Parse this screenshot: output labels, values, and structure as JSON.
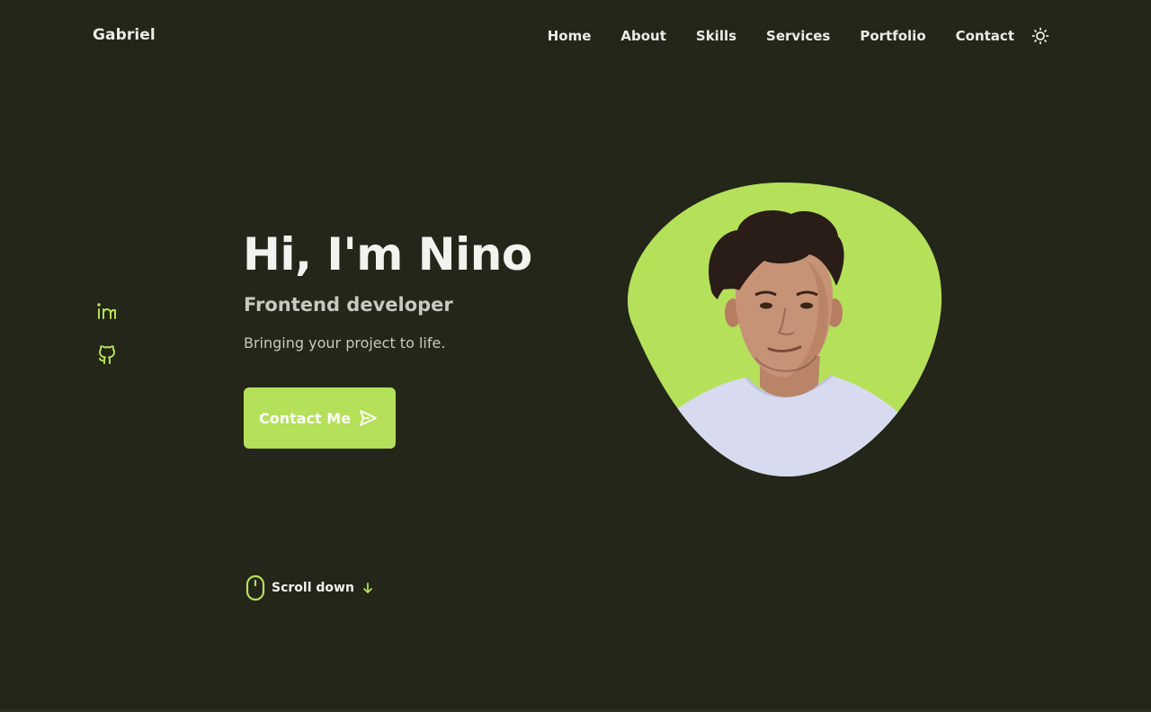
{
  "header": {
    "logo": "Gabriel",
    "nav": [
      {
        "label": "Home"
      },
      {
        "label": "About"
      },
      {
        "label": "Skills"
      },
      {
        "label": "Services"
      },
      {
        "label": "Portfolio"
      },
      {
        "label": "Contact"
      }
    ],
    "theme_icon": "sun-icon"
  },
  "social": [
    {
      "icon": "linkedin-icon"
    },
    {
      "icon": "github-icon"
    }
  ],
  "hero": {
    "title": "Hi, I'm Nino",
    "subtitle": "Frontend developer",
    "description": "Bringing your project to life.",
    "cta_label": "Contact Me",
    "cta_icon": "send-icon",
    "portrait": "profile-photo"
  },
  "scroll": {
    "label": "Scroll down",
    "icon": "mouse-icon",
    "arrow_icon": "arrow-down-icon"
  },
  "colors": {
    "background": "#232619",
    "accent": "#b5e05a",
    "text": "#f2f2ee",
    "muted_text": "#c8c9bf"
  }
}
